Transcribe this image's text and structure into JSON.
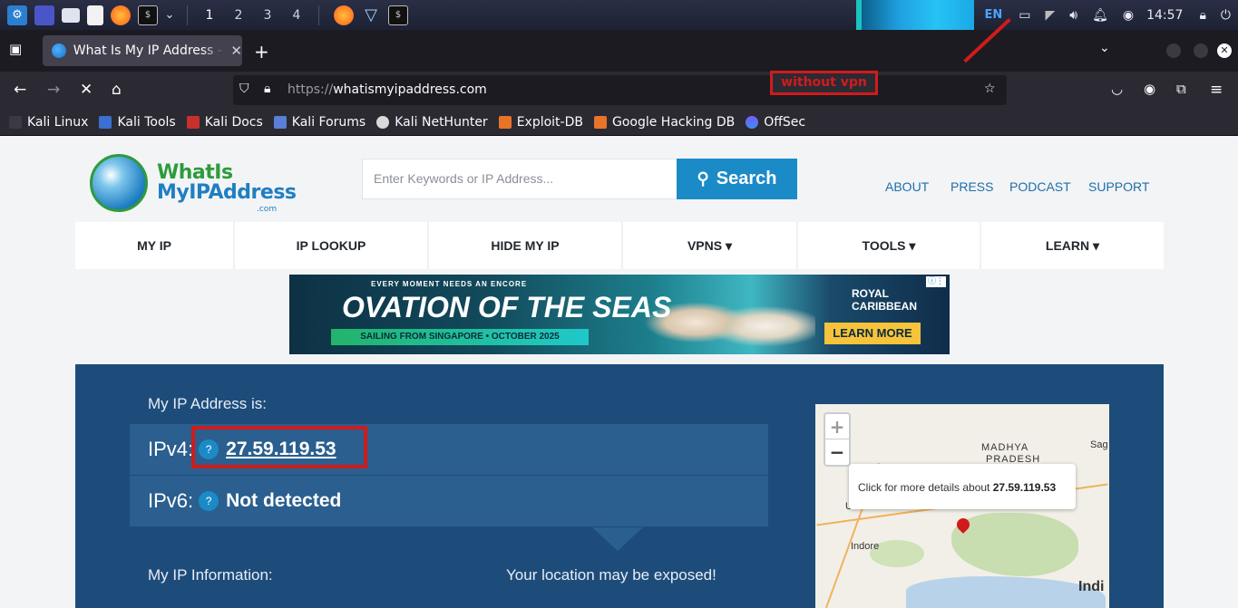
{
  "taskbar": {
    "workspaces": [
      "1",
      "2",
      "3",
      "4"
    ],
    "lang": "EN",
    "clock": "14:57"
  },
  "browser": {
    "tab_title": "What Is My IP Address - S",
    "url_proto": "https://",
    "url_host": "whatismyipaddress.com",
    "bookmarks": [
      "Kali Linux",
      "Kali Tools",
      "Kali Docs",
      "Kali Forums",
      "Kali NetHunter",
      "Exploit-DB",
      "Google Hacking DB",
      "OffSec"
    ]
  },
  "annotation": {
    "label": "without vpn",
    "color": "#d11b1b"
  },
  "site": {
    "logo_line1": "WhatIs",
    "logo_line2": "MyIPAddress",
    "logo_com": ".com",
    "search_placeholder": "Enter Keywords or IP Address...",
    "search_button": "Search",
    "top_links": [
      "ABOUT",
      "PRESS",
      "PODCAST",
      "SUPPORT"
    ],
    "nav": [
      "MY IP",
      "IP LOOKUP",
      "HIDE MY IP",
      "VPNS ▾",
      "TOOLS ▾",
      "LEARN ▾"
    ]
  },
  "ad": {
    "tagline": "EVERY MOMENT NEEDS AN ENCORE",
    "headline": "OVATION OF THE SEAS",
    "strip": "SAILING FROM SINGAPORE • OCTOBER 2025",
    "brand": "ROYAL CARIBBEAN",
    "cta": "LEARN MORE"
  },
  "ip": {
    "heading": "My IP Address is:",
    "ipv4_label": "IPv4:",
    "ipv4_value": "27.59.119.53",
    "ipv6_label": "IPv6:",
    "ipv6_value": "Not detected",
    "help_symbol": "?",
    "info_heading": "My IP Information:",
    "exposed_text": "Your location may be exposed!"
  },
  "map": {
    "popup_prefix": "Click for more details about ",
    "popup_ip": "27.59.119.53",
    "zoom_in": "+",
    "zoom_out": "−",
    "labels": [
      "MADHYA",
      "PRADESH",
      "Sag",
      "Indore",
      "Indi",
      "U"
    ]
  },
  "colors": {
    "hero_bg": "#1e4c7a",
    "row_bg": "#2a5f8f",
    "brand_blue": "#1b8bc8"
  }
}
